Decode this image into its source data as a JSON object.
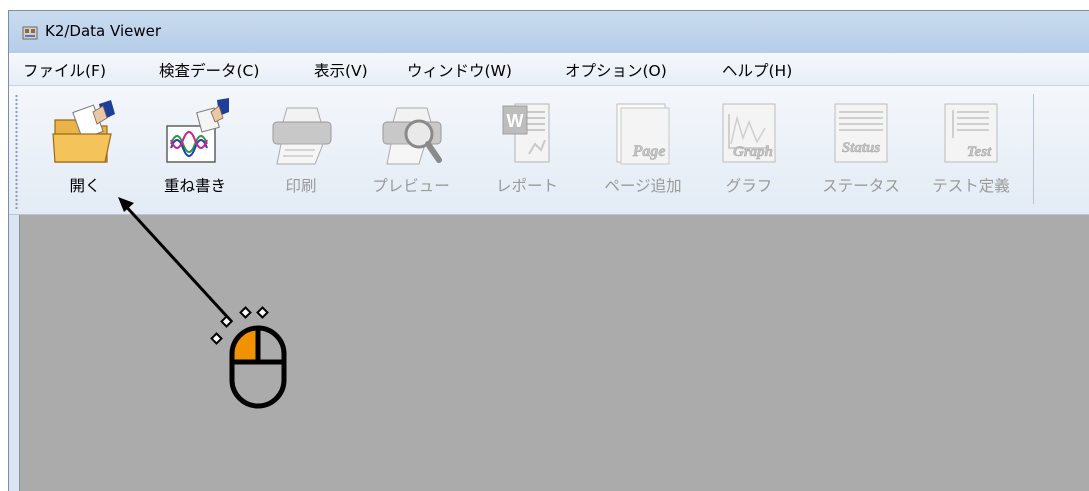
{
  "window": {
    "title": "K2/Data Viewer",
    "icon": "k2-app-icon"
  },
  "menu": [
    {
      "label": "ファイル(F)",
      "name": "menu-file"
    },
    {
      "label": "検査データ(C)",
      "name": "menu-inspection-data"
    },
    {
      "label": "表示(V)",
      "name": "menu-view"
    },
    {
      "label": "ウィンドウ(W)",
      "name": "menu-window"
    },
    {
      "label": "オプション(O)",
      "name": "menu-options"
    },
    {
      "label": "ヘルプ(H)",
      "name": "menu-help"
    }
  ],
  "toolbar": {
    "open": {
      "label": "開く",
      "icon": "open-folder-icon",
      "enabled": true
    },
    "overlay": {
      "label": "重ね書き",
      "icon": "overlay-waveform-icon",
      "enabled": true
    },
    "print": {
      "label": "印刷",
      "icon": "printer-icon",
      "enabled": false
    },
    "preview": {
      "label": "プレビュー",
      "icon": "print-preview-icon",
      "enabled": false
    },
    "report": {
      "label": "レポート",
      "icon": "word-report-icon",
      "enabled": false
    },
    "add_page": {
      "label": "ページ追加",
      "icon": "add-page-icon",
      "icon_text": "Page",
      "enabled": false
    },
    "graph": {
      "label": "グラフ",
      "icon": "graph-icon",
      "icon_text": "Graph",
      "enabled": false
    },
    "status": {
      "label": "ステータス",
      "icon": "status-icon",
      "icon_text": "Status",
      "enabled": false
    },
    "test_def": {
      "label": "テスト定義",
      "icon": "test-definition-icon",
      "icon_text": "Test",
      "enabled": false
    }
  },
  "annotation": {
    "cursor_icon": "mouse-left-click-icon",
    "click_button": "left",
    "accent_color": "#f39200",
    "pointer": "arrow-to-open-button"
  },
  "colors": {
    "titlebar": "#bfd4ec",
    "workspace": "#ababab",
    "disabled_text": "#9a9a9a"
  }
}
